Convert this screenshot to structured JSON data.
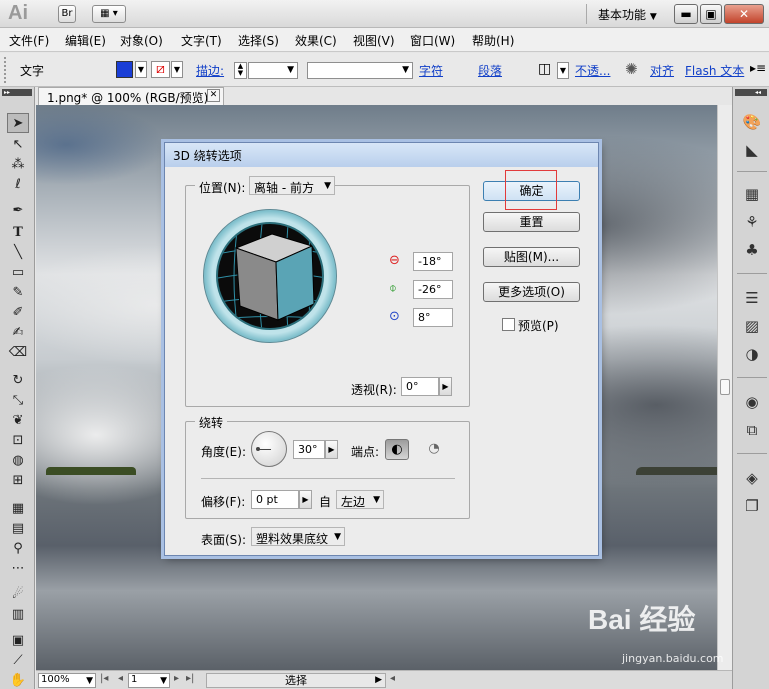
{
  "app": {
    "logo": "Ai",
    "br_label": "Br",
    "workspace": "基本功能"
  },
  "menu": {
    "items": [
      "文件(F)",
      "编辑(E)",
      "对象(O)",
      "文字(T)",
      "选择(S)",
      "效果(C)",
      "视图(V)",
      "窗口(W)",
      "帮助(H)"
    ]
  },
  "control": {
    "tool_label": "文字",
    "stroke_label": "描边:",
    "char_link": "字符",
    "para_link": "段落",
    "opacity_link": "不透...",
    "align_link": "对齐",
    "flash_link": "Flash 文本",
    "fill_color": "#1a3ed6"
  },
  "document": {
    "tab_title": "1.png* @ 100% (RGB/预览)"
  },
  "status": {
    "zoom": "100%",
    "page": "1",
    "tool": "选择"
  },
  "dialog": {
    "title": "3D 绕转选项",
    "position_label": "位置(N):",
    "position_value": "离轴 - 前方",
    "x_rot": "-18°",
    "y_rot": "-26°",
    "z_rot": "8°",
    "perspective_label": "透视(R):",
    "perspective_value": "0°",
    "revolve_group": "绕转",
    "angle_label": "角度(E):",
    "angle_value": "30°",
    "cap_label": "端点:",
    "offset_label": "偏移(F):",
    "offset_value": "0 pt",
    "from_label": "自",
    "from_value": "左边",
    "surface_label": "表面(S):",
    "surface_value": "塑料效果底纹",
    "ok": "确定",
    "reset": "重置",
    "map": "贴图(M)...",
    "more": "更多选项(O)",
    "preview": "预览(P)"
  },
  "watermark": {
    "text": "Bai 经验",
    "sub": "jingyan.baidu.com"
  }
}
